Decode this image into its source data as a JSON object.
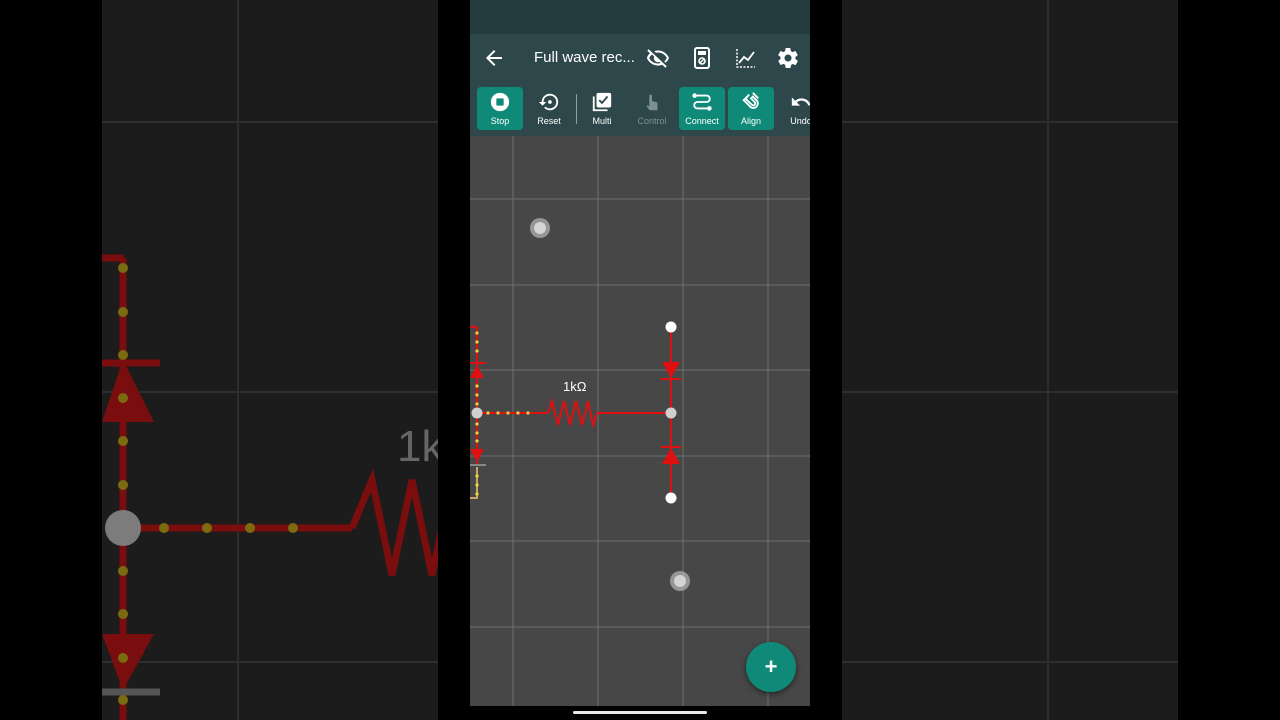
{
  "app": {
    "title": "Full wave rec...",
    "toolbar": [
      {
        "label": "Stop",
        "state": "active",
        "icon": "stop-icon"
      },
      {
        "label": "Reset",
        "state": "normal",
        "icon": "reset-icon"
      },
      {
        "label": "Multi",
        "state": "normal",
        "icon": "multi-select-icon"
      },
      {
        "label": "Control",
        "state": "disabled",
        "icon": "touch-control-icon"
      },
      {
        "label": "Connect",
        "state": "active",
        "icon": "connect-wire-icon"
      },
      {
        "label": "Align",
        "state": "active",
        "icon": "align-magnet-icon"
      },
      {
        "label": "Undo",
        "state": "normal",
        "icon": "undo-icon"
      }
    ],
    "appbar_icons": [
      "back-arrow-icon",
      "visibility-off-icon",
      "meter-icon",
      "graph-icon",
      "settings-gear-icon"
    ]
  },
  "canvas": {
    "resistor_label": "1kΩ",
    "fab_label": "+"
  },
  "background": {
    "left_label": "1k"
  },
  "colors": {
    "accent": "#0f8a78",
    "appbar": "#2e474b",
    "wire": "#e01010",
    "canvas": "#474747"
  }
}
